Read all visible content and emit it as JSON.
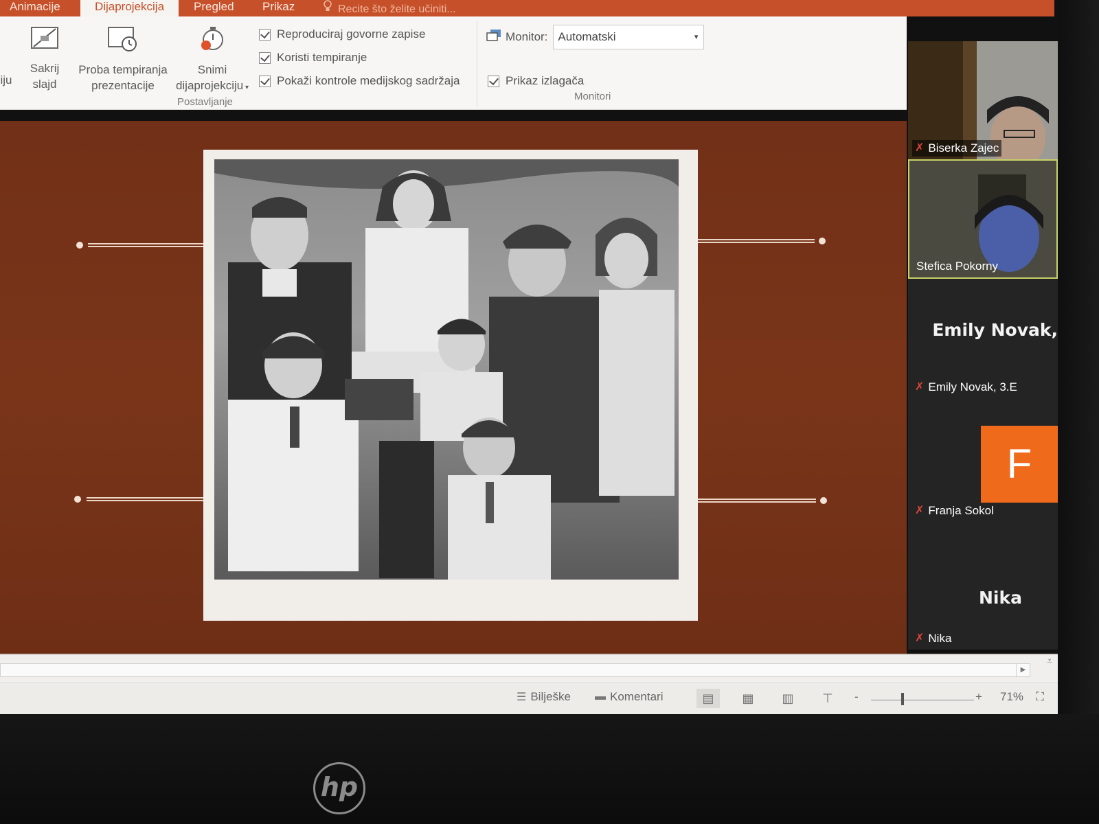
{
  "ribbon": {
    "tabs": [
      {
        "label": "Animacije"
      },
      {
        "label": "Dijaprojekcija"
      },
      {
        "label": "Pregled"
      },
      {
        "label": "Prikaz"
      }
    ],
    "tell_me": "Recite što želite učiniti..."
  },
  "setup_group": {
    "left_button_lines": [
      "i",
      "ciju"
    ],
    "hide_slide": {
      "line1": "Sakrij",
      "line2": "slajd"
    },
    "rehearse": {
      "line1": "Proba tempiranja",
      "line2": "prezentacije"
    },
    "record": {
      "line1": "Snimi",
      "line2": "dijaprojekciju"
    },
    "checkboxes": [
      {
        "label": "Reproduciraj govorne zapise",
        "checked": true
      },
      {
        "label": "Koristi tempiranje",
        "checked": true
      },
      {
        "label": "Pokaži kontrole medijskog sadržaja",
        "checked": true
      }
    ],
    "group_label": "Postavljanje"
  },
  "monitors_group": {
    "monitor_label": "Monitor:",
    "monitor_value": "Automatski",
    "presenter_view_label": "Prikaz izlagača",
    "presenter_view_checked": true,
    "group_label": "Monitori"
  },
  "participants": [
    {
      "name": "Biserka Zajec",
      "muted": true,
      "type": "video"
    },
    {
      "name": "Stefica Pokorny",
      "muted": false,
      "type": "video",
      "active_speaker": true
    },
    {
      "name": "Emily Novak, 3.E",
      "display_name": "Emily Novak,",
      "muted": true,
      "type": "name"
    },
    {
      "name": "Franja Sokol",
      "avatar_letter": "F",
      "muted": true,
      "type": "avatar"
    },
    {
      "name": "Nika",
      "display_name": "Nika",
      "muted": true,
      "type": "name"
    }
  ],
  "status_bar": {
    "notes_label": "Bilješke",
    "comments_label": "Komentari",
    "zoom_minus": "-",
    "zoom_plus": "+",
    "zoom_value": "71%"
  },
  "monitor": {
    "brand": "hp"
  },
  "colors": {
    "accent": "#c6502a",
    "slide_bg": "#74321a",
    "avatar_orange": "#f06a1c",
    "speaker_border": "#c7d266",
    "mute_red": "#e0463a"
  }
}
